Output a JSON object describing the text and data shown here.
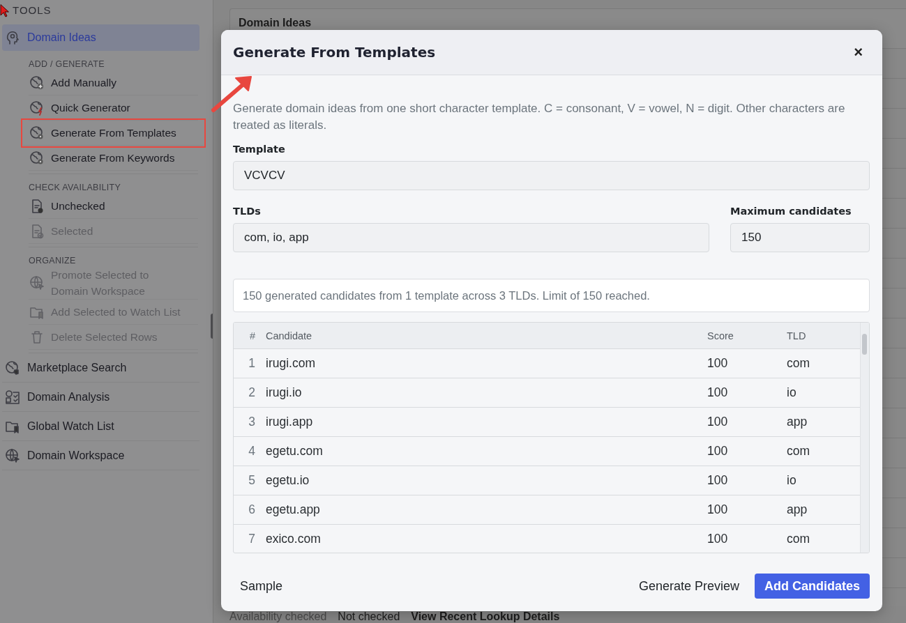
{
  "sidebar": {
    "heading": "TOOLS",
    "items": [
      {
        "label": "Domain Ideas",
        "selected": true,
        "groups": [
          {
            "heading": "ADD / GENERATE",
            "items": [
              {
                "label": "Add Manually",
                "disabled": false,
                "annotated": false
              },
              {
                "label": "Quick Generator",
                "disabled": false,
                "annotated": false
              },
              {
                "label": "Generate From Templates",
                "disabled": false,
                "annotated": true
              },
              {
                "label": "Generate From Keywords",
                "disabled": false,
                "annotated": false
              }
            ]
          },
          {
            "heading": "CHECK AVAILABILITY",
            "items": [
              {
                "label": "Unchecked",
                "disabled": false,
                "annotated": false
              },
              {
                "label": "Selected",
                "disabled": true,
                "annotated": false
              }
            ]
          },
          {
            "heading": "ORGANIZE",
            "items": [
              {
                "label": "Promote Selected to Domain Workspace",
                "disabled": true,
                "annotated": false
              },
              {
                "label": "Add Selected to Watch List",
                "disabled": true,
                "annotated": false
              },
              {
                "label": "Delete Selected Rows",
                "disabled": true,
                "annotated": false
              }
            ]
          }
        ]
      },
      {
        "label": "Marketplace Search",
        "selected": false
      },
      {
        "label": "Domain Analysis",
        "selected": false
      },
      {
        "label": "Global Watch List",
        "selected": false
      },
      {
        "label": "Domain Workspace",
        "selected": false
      }
    ]
  },
  "background": {
    "card_title": "Domain Ideas",
    "status": {
      "label": "Availability checked",
      "value": "Not checked",
      "link": "View Recent Lookup Details"
    }
  },
  "dialog": {
    "title": "Generate From Templates",
    "close": "×",
    "description": "Generate domain ideas from one short character template. C = consonant, V = vowel, N = digit. Other characters are treated as literals.",
    "template": {
      "label": "Template",
      "value": "VCVCV"
    },
    "tlds": {
      "label": "TLDs",
      "value": "com, io, app"
    },
    "maximum": {
      "label": "Maximum candidates",
      "value": "150"
    },
    "summary": "150 generated candidates from 1 template across 3 TLDs. Limit of 150 reached.",
    "table": {
      "columns": [
        "#",
        "Candidate",
        "Score",
        "TLD"
      ],
      "rows": [
        [
          "1",
          "irugi.com",
          "100",
          "com"
        ],
        [
          "2",
          "irugi.io",
          "100",
          "io"
        ],
        [
          "3",
          "irugi.app",
          "100",
          "app"
        ],
        [
          "4",
          "egetu.com",
          "100",
          "com"
        ],
        [
          "5",
          "egetu.io",
          "100",
          "io"
        ],
        [
          "6",
          "egetu.app",
          "100",
          "app"
        ],
        [
          "7",
          "exico.com",
          "100",
          "com"
        ]
      ]
    },
    "buttons": [
      {
        "label": "Sample",
        "kind": "text"
      },
      {
        "label": "Generate Preview",
        "kind": "text"
      },
      {
        "label": "Add Candidates",
        "kind": "primary"
      }
    ]
  }
}
